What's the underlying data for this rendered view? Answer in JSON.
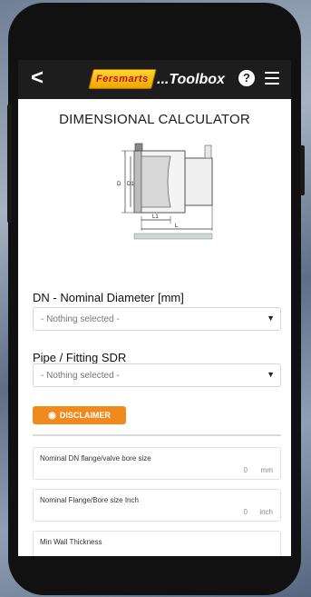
{
  "header": {
    "back": "<",
    "brand": "Fersmarts",
    "title": "...Toolbox",
    "help": "?"
  },
  "page_title": "DIMENSIONAL CALCULATOR",
  "diagram": {
    "labels": [
      "D",
      "D1",
      "L1",
      "L"
    ]
  },
  "dn_select": {
    "label": "DN - Nominal Diameter [mm]",
    "value": "- Nothing selected -"
  },
  "sdr_select": {
    "label": "Pipe / Fitting SDR",
    "value": "- Nothing selected -"
  },
  "disclaimer_label": "DISCLAIMER",
  "fields": [
    {
      "label": "Nominal DN flange/valve bore size",
      "value": "0",
      "unit": "mm"
    },
    {
      "label": "Nominal Flange/Bore size Inch",
      "value": "0",
      "unit": "inch"
    },
    {
      "label": "Min Wall Thickness",
      "value": "",
      "unit": ""
    }
  ],
  "colors": {
    "topbar": "#1d1d1d",
    "accent": "#f08a1c"
  }
}
